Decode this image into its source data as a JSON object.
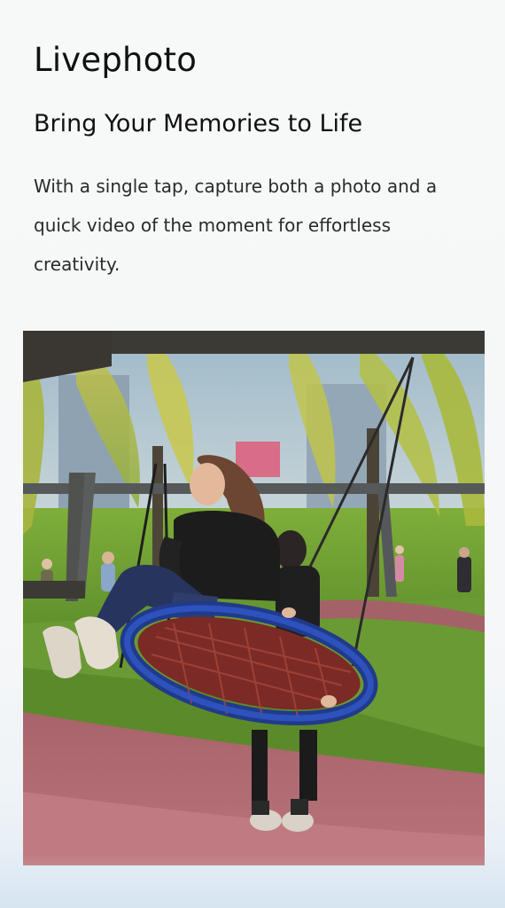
{
  "header": {
    "app_title": "Livephoto"
  },
  "feature": {
    "subtitle": "Bring Your Memories to Life",
    "description": "With a single tap, capture both a photo and a quick video of the moment for effortless creativity."
  }
}
